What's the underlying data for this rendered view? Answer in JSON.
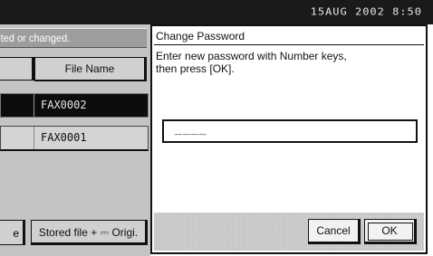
{
  "status_bar": {
    "date_time": "15AUG  2002  8:50"
  },
  "left_panel": {
    "message": "leted or changed.",
    "column_header": "File Name",
    "files": [
      {
        "name": "FAX0002",
        "selected": true
      },
      {
        "name": "FAX0001",
        "selected": false
      }
    ],
    "stub_button_label": "e",
    "stored_button_label": "Stored file + ⎓ Origi."
  },
  "dialog": {
    "title": "Change Password",
    "message_line1": "Enter new password with Number keys,",
    "message_line2": "then press [OK].",
    "password_value": "____",
    "cancel_label": "Cancel",
    "ok_label": "OK"
  }
}
